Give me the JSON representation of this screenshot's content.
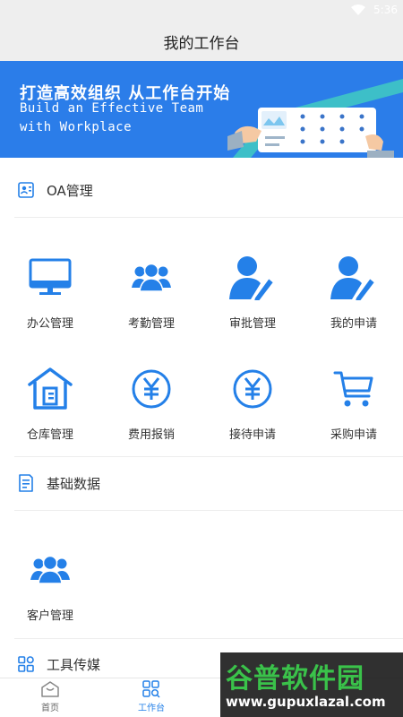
{
  "status_bar": {
    "time": "5:36"
  },
  "header": {
    "title": "我的工作台"
  },
  "banner": {
    "line1": "打造高效组织 从工作台开始",
    "line2": "Build an Effective Team",
    "line3": "with Workplace"
  },
  "sections": {
    "oa": {
      "title": "OA管理",
      "items": [
        {
          "label": "办公管理",
          "icon": "monitor-icon"
        },
        {
          "label": "考勤管理",
          "icon": "group-icon"
        },
        {
          "label": "审批管理",
          "icon": "user-edit-icon"
        },
        {
          "label": "我的申请",
          "icon": "user-edit-icon"
        },
        {
          "label": "仓库管理",
          "icon": "warehouse-icon"
        },
        {
          "label": "费用报销",
          "icon": "yen-circle-icon"
        },
        {
          "label": "接待申请",
          "icon": "yen-circle-icon"
        },
        {
          "label": "采购申请",
          "icon": "cart-icon"
        }
      ]
    },
    "basic": {
      "title": "基础数据",
      "items": [
        {
          "label": "客户管理",
          "icon": "group-icon"
        }
      ]
    },
    "tools": {
      "title": "工具传媒"
    }
  },
  "bottom_nav": [
    {
      "label": "首页",
      "icon": "home-icon",
      "active": false
    },
    {
      "label": "工作台",
      "icon": "workbench-icon",
      "active": true
    }
  ],
  "watermark": {
    "line1": "谷普软件园",
    "line2": "www.gupuxlazal.com"
  },
  "colors": {
    "accent": "#2480e8",
    "banner": "#2b7de9",
    "inactive": "#888888"
  }
}
